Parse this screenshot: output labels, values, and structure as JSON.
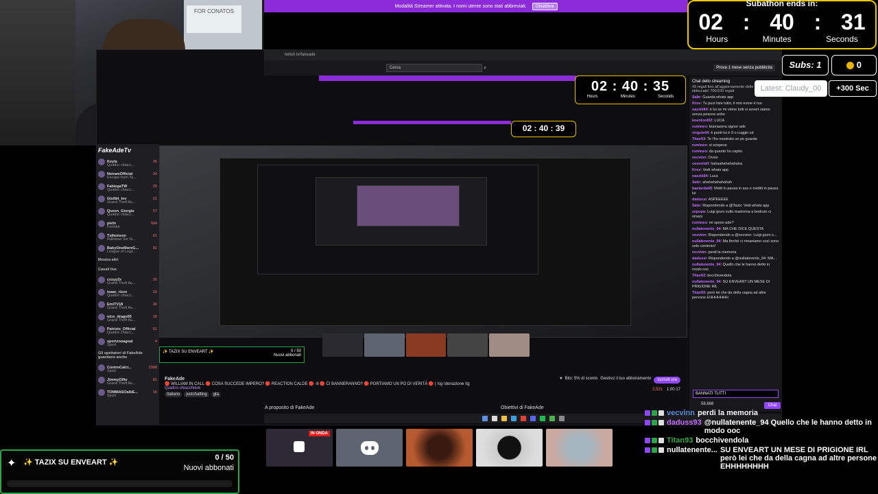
{
  "streamer_bar": {
    "message": "Modalità Streamer attivata. I nomi utente sono stati abbreviati.",
    "button": "Disattiva"
  },
  "webcam": {
    "sign": "FOR CONATOS"
  },
  "browser": {
    "url": "twitch.tv/fakeade",
    "search_value": "Cerca",
    "promo": "Prova 1 mese senza pubblicità"
  },
  "timer": {
    "header": "Subathon ends in:",
    "hours": "02",
    "minutes": "40",
    "seconds": "31",
    "hours_label": "Hours",
    "minutes_label": "Minutes",
    "seconds_label": "Seconds",
    "inner_mid": "02 : 40 : 35",
    "inner_small": "02 : 40 : 39"
  },
  "stats": {
    "subs": "Subs: 1",
    "coins": "0",
    "latest": "Latest: Claudy_00",
    "plus": "+300 Sec"
  },
  "sidebar": {
    "overlay_name": "FakeAdeTv",
    "channels": [
      {
        "name": "Keyla",
        "game": "Quattro chiacc...",
        "count": "26"
      },
      {
        "name": "NeiramOfficial",
        "game": "Escape from Ta...",
        "count": "34"
      },
      {
        "name": "FabiegaTW",
        "game": "Quattro chiacc...",
        "count": "25"
      },
      {
        "name": "Giulbit_txv",
        "game": "Grand Theft Au...",
        "count": "21"
      },
      {
        "name": "Queen_Giorgia",
        "game": "Quattro chiacc...",
        "count": "57"
      },
      {
        "name": "piefn",
        "game": "Fortnite",
        "count": "904"
      },
      {
        "name": "Tvjhonson",
        "game": "Rainbow Six Si...",
        "count": "61"
      },
      {
        "name": "BabyOneMoreG...",
        "game": "League of Lege...",
        "count": "81"
      }
    ],
    "show_more": "Mostra altri",
    "live_header": "Canali live",
    "live_channels": [
      {
        "name": "cxzyy2x",
        "game": "Grand Theft Au...",
        "count": "26"
      },
      {
        "name": "isaac_rizzo",
        "game": "Quattro chiacc...",
        "count": "16"
      },
      {
        "name": "EmiTV18",
        "game": "Grand Theft Au...",
        "count": "36"
      },
      {
        "name": "nico_drago05",
        "game": "Grand Theft Au...",
        "count": "18"
      },
      {
        "name": "Patrizio_Official",
        "game": "Quattro chiacc...",
        "count": "51"
      },
      {
        "name": "sportznoagoal",
        "game": "Sport",
        "count": "4"
      }
    ],
    "viewers_header": "Gli spettatori di FakeAde guardano anche",
    "viewer_channels": [
      {
        "name": "ControCalci...",
        "game": "Sport",
        "count": "2398"
      },
      {
        "name": "JimmyO0tv",
        "game": "Grand Theft Au...",
        "count": "81"
      },
      {
        "name": "TOMMASOalbE...",
        "game": "Sport",
        "count": "16"
      }
    ]
  },
  "share_panel": {
    "title": "✨ TAZIX SU ENVEART ✨",
    "count": "0 / 50",
    "sub": "Nuovi abbonati"
  },
  "stream_info": {
    "name": "FakeAde",
    "title": "🔴 WILLIAM IN CALL 🔴 COSA SUCCEDE IMPERO? 🔴 REACTION CALDE 🔴 -8 🔴 CI BANNERANNO? 🔴 PORTIAMO UN PO DI VERITÀ 🔴 | !sg !donazione !tg",
    "category": "Quattro chiacchiere",
    "tags": [
      "Italiano",
      "justchatting",
      "gta"
    ],
    "bits": "Bits: 5% di sconto",
    "gift": "Gestisci il tuo abbonamento",
    "sub_button": "Iscriviti ora",
    "viewers": "2,531",
    "uptime": "1:00:17"
  },
  "about": {
    "left": "A proposito di FakeAde",
    "right": "Obiettivi di FakeAde"
  },
  "share_chat": {
    "title": "Chat dello streaming",
    "pinned": "43 regali fino all'aggiornamento delle ricompense sbloccate! 700/100 regali",
    "lines": [
      {
        "user": "Sabr",
        "msg": "Guarda whats app"
      },
      {
        "user": "Krov",
        "msg": "Tu puoi fare tutto, il mio nome è tuo"
      },
      {
        "user": "nazzik84",
        "msg": "è lui se mi viene tutti si avvert siamo senza peacoe anhe"
      },
      {
        "user": "koenlord02",
        "msg": "LUCA"
      },
      {
        "user": "rumineo",
        "msg": "buonasera signor ade"
      },
      {
        "user": "virgule44",
        "msg": "è punti lui è 9 o cuggin xd"
      },
      {
        "user": "Titan93",
        "msg": "Te l'ho mostrato un po guarda"
      },
      {
        "user": "rumineo",
        "msg": "si sospese"
      },
      {
        "user": "rumineo",
        "msg": "da quanto ho capito"
      },
      {
        "user": "vecvinn",
        "msg": "Ovvio"
      },
      {
        "user": "cosonioll",
        "msg": "hahaahahahahaha"
      },
      {
        "user": "Krov",
        "msg": "Vedi whats app"
      },
      {
        "user": "nazzik84",
        "msg": "Luca"
      },
      {
        "user": "Sabr",
        "msg": "ahahahahahahah"
      },
      {
        "user": "bastarda45",
        "msg": "Metti in pausa in ass e mettiti in pausa lui"
      },
      {
        "user": "dadussi",
        "msg": "ASPEEEEE"
      },
      {
        "user": "Sabr",
        "msg": "Rispondendo a @Tazix: Vedi whats app"
      },
      {
        "user": "zepupa",
        "msg": "Luigi giuro sulla madonna a bodrum ci rimani"
      },
      {
        "user": "rumineo",
        "msg": "mi sposo ade?"
      },
      {
        "user": "nullatenente_94",
        "msg": "MA CHE DICE QUESTA"
      },
      {
        "user": "vecvinn",
        "msg": "Rispondendo a @vecvinn: Luigi giuro s..."
      },
      {
        "user": "nullatenente_94",
        "msg": "Ma finché ci rimaniamo così sono solo contento!"
      },
      {
        "user": "vecvinn",
        "msg": "perdi la memoria"
      },
      {
        "user": "dadussi",
        "msg": "Rispondendo a @nullatenente_94: MA..."
      },
      {
        "user": "nullatenente_94",
        "msg": "Quello che le hanno detto in modo ooc"
      },
      {
        "user": "Titan93",
        "msg": "bocchivendola"
      },
      {
        "user": "nullatenente_94",
        "msg": "SU ENVEART UN MESE DI PRIGIONE IRL"
      },
      {
        "user": "Titan93",
        "msg": "però lei che da della cagna ad altre persone EHHHHHHH"
      }
    ],
    "input": "BANNATI TUTTI",
    "points": "58,668",
    "send": "Chat"
  },
  "sub_goal": {
    "title": "✨ TAZIX SU ENVEART ✨",
    "count": "0 / 50",
    "sub": "Nuovi abbonati",
    "progress": 0
  },
  "thumbs": {
    "live_label": "IN ONDA"
  },
  "overlay_chat": [
    {
      "user": "vecvinn",
      "color": "#5b8de0",
      "msg": "perdi la memoria"
    },
    {
      "user": "daduss93",
      "color": "#c36bff",
      "msg": "@nullatenente_94 Quello che le hanno detto in modo ooc"
    },
    {
      "user": "Titan93",
      "color": "#3aa84a",
      "msg": "bocchivendola"
    },
    {
      "user": "nullatenente...",
      "color": "#ffffff",
      "msg": "SU ENVEART UN MESE DI PRIGIONE IRL però lei che da della cagna ad altre persone EHHHHHHHH"
    }
  ],
  "colors": {
    "accent": "#9147ff",
    "streamer_bar": "#8b2bd9",
    "timer_border": "#f0c800",
    "goal_border": "#2aa54a"
  }
}
